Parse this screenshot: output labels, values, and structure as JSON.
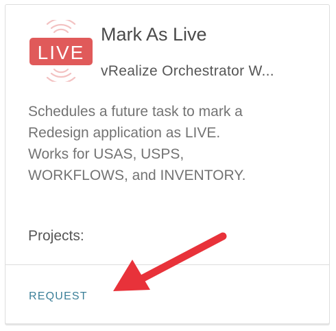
{
  "card": {
    "logo_text": "LIVE",
    "title": "Mark As Live",
    "subtitle": "vRealize Orchestrator W...",
    "description": " Schedules a future task to mark a\nRedesign application as LIVE.\nWorks for USAS, USPS,\nWORKFLOWS, and INVENTORY.",
    "projects_label": "Projects:",
    "request_label": "REQUEST"
  },
  "colors": {
    "logo_red": "#e05a5a",
    "logo_ring": "#f3c2c2",
    "link": "#3b7f98",
    "arrow": "#e8323a"
  },
  "icons": {
    "logo": "live-broadcast-icon",
    "annotation": "red-arrow"
  }
}
